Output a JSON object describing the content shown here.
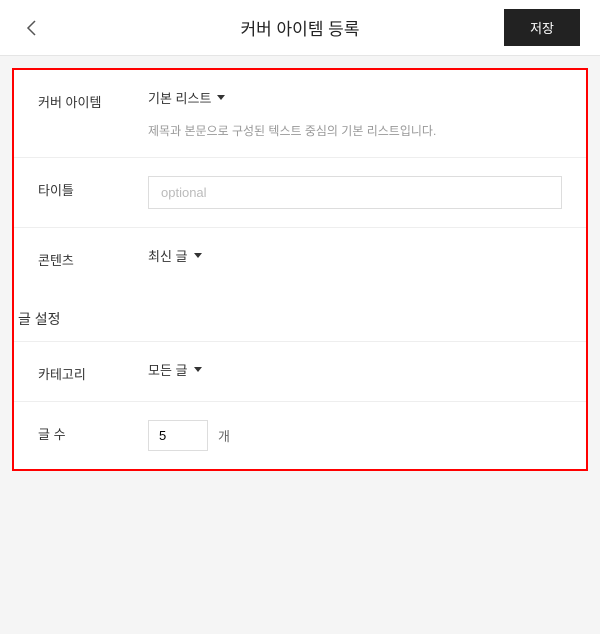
{
  "header": {
    "title": "커버 아이템 등록",
    "save_label": "저장"
  },
  "form": {
    "cover_item": {
      "label": "커버 아이템",
      "value": "기본 리스트",
      "description": "제목과 본문으로 구성된 텍스트 중심의 기본 리스트입니다."
    },
    "title": {
      "label": "타이틀",
      "placeholder": "optional",
      "value": ""
    },
    "content": {
      "label": "콘텐츠",
      "value": "최신 글"
    }
  },
  "post_settings": {
    "section_title": "글 설정",
    "category": {
      "label": "카테고리",
      "value": "모든 글"
    },
    "count": {
      "label": "글 수",
      "value": "5",
      "unit": "개"
    }
  }
}
